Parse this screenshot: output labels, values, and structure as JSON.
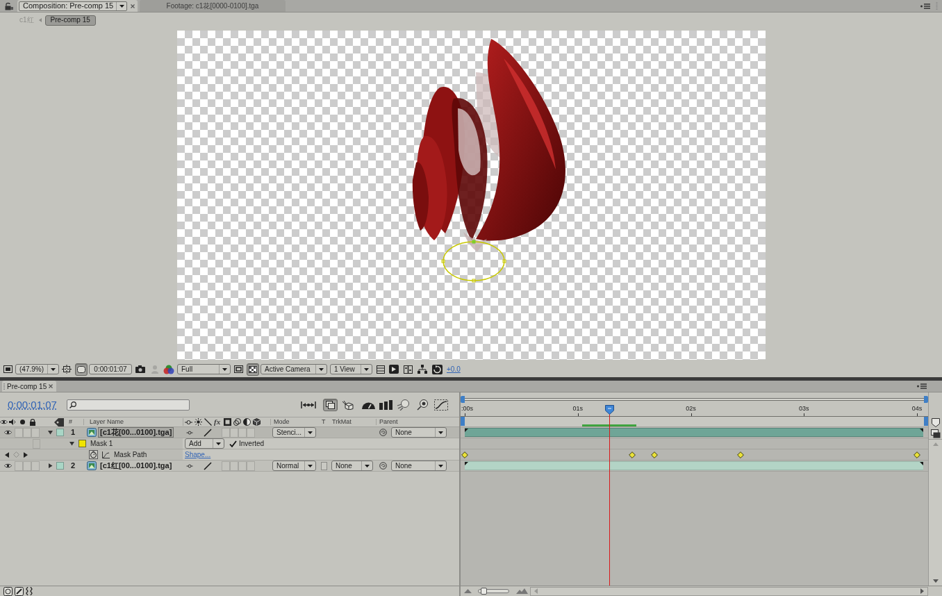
{
  "composition_tabs": [
    {
      "label": "Composition: Pre-comp 15",
      "selected": true
    },
    {
      "label": "Footage: c1花[0000-0100].tga",
      "selected": false
    }
  ],
  "breadcrumbs": [
    {
      "label": "c1红",
      "selected": false
    },
    {
      "label": "Pre-comp 15",
      "selected": true
    }
  ],
  "viewer_toolbar": {
    "magnification": "(47.9%)",
    "mask_visibility_on": true,
    "timecode": "0:00:01:07",
    "resolution": "Full",
    "transparency_grid_on": true,
    "view": "Active Camera",
    "layout": "1 View",
    "exposure": "+0.0"
  },
  "timeline": {
    "tab": "Pre-comp 15",
    "current_time": "0:00:01:07",
    "live_update_on": true,
    "columns": {
      "number": "#",
      "name": "Layer Name",
      "effects": "fx",
      "mode": "Mode",
      "preserve_transparency": "T",
      "track_matte": "TrkMat",
      "parent": "Parent"
    },
    "ruler": [
      ":00s",
      "01s",
      "02s",
      "03s",
      "04s"
    ],
    "playhead": {
      "level": 0.32
    },
    "rows": [
      {
        "kind": "layer",
        "number": "1",
        "name": "[c1花[00...0100].tga]",
        "visible": true,
        "expanded": true,
        "selected": true,
        "mode": "Stenci...",
        "parent": "None"
      },
      {
        "kind": "mask",
        "name": "Mask 1",
        "color": "#f0e400",
        "expanded": true,
        "mode": "Add",
        "inverted": true,
        "inverted_label": "Inverted"
      },
      {
        "kind": "property",
        "name": "Mask Path",
        "value": "Shape...",
        "keyframes": [
          {
            "level": 0
          },
          {
            "level": 0.37
          },
          {
            "level": 0.42
          },
          {
            "level": 0.61
          },
          {
            "level": 1
          }
        ]
      },
      {
        "kind": "layer",
        "number": "2",
        "name": "[c1红[00...0100].tga]",
        "visible": true,
        "expanded": false,
        "selected": false,
        "mode": "Normal",
        "preserve_transparency": false,
        "track_matte": "None",
        "parent": "None"
      }
    ],
    "zoom_slider": {
      "level": 0.08
    }
  }
}
